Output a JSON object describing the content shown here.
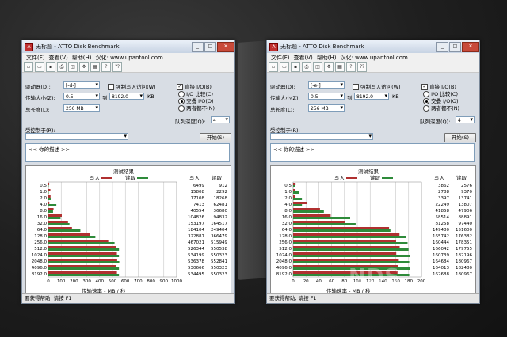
{
  "windows": [
    {
      "title": "无标题 - ATTO Disk Benchmark",
      "menu": [
        "文件(F)",
        "查看(V)",
        "帮助(H)",
        "汉化: www.upantool.com"
      ],
      "drive_label": "驱动器(D):",
      "drive_value": "[-d-]",
      "force_write_label": "强制写入访问(W)",
      "direct_io_label": "直接 I/O(B)",
      "transfer_label": "传输大小(Z):",
      "transfer_from": "0.5",
      "transfer_to_label": "到",
      "transfer_to": "8192.0",
      "transfer_unit": "KB",
      "length_label": "总长度(L):",
      "length_value": "256 MB",
      "io_compare_label": "I/O 比较(C)",
      "overlap_label": "交叠 I/O(O)",
      "neither_label": "两者都不(N)",
      "queue_label": "队列深度(Q):",
      "queue_value": "4",
      "controlled_label": "受控制于(R):",
      "start_button": "开始(S)",
      "desc_text": "<<  你的描述  >>",
      "results_title": "测试结果",
      "write_label": "写入",
      "read_label": "读取",
      "col_write": "写入",
      "col_read": "读取",
      "axis_label": "传输速率 - MB / 秒",
      "status": "要获得帮助, 请按 F1",
      "chart_data": {
        "type": "bar",
        "title": "测试结果",
        "xlabel": "传输速率 - MB / 秒",
        "xlim": [
          0,
          1000
        ],
        "xticks": [
          "0",
          "100",
          "200",
          "300",
          "400",
          "500",
          "600",
          "700",
          "800",
          "900",
          "1000"
        ],
        "categories": [
          "0.5",
          "1.0",
          "2.0",
          "4.0",
          "8.0",
          "16.0",
          "32.0",
          "64.0",
          "128.0",
          "256.0",
          "512.0",
          "1024.0",
          "2048.0",
          "4096.0",
          "8192.0"
        ],
        "series": [
          {
            "name": "写入",
            "color": "#b03030",
            "values": [
              6.499,
              15.808,
              17.108,
              7.413,
              40.554,
              104.826,
              153.197,
              184.104,
              322887,
              467021,
              526344,
              534199,
              536378,
              530666,
              534495
            ],
            "display": [
              "6499",
              "15808",
              "17108",
              "7413",
              "40554",
              "104826",
              "153197",
              "184104",
              "322887",
              "467021",
              "526344",
              "534199",
              "536378",
              "530666",
              "534495"
            ]
          },
          {
            "name": "读取",
            "color": "#2e8b3a",
            "values": [
              0.912,
              2.292,
              18.268,
              62.481,
              36.68,
              94.832,
              164.517,
              249.404,
              366.479,
              515.949,
              550.538,
              550.323,
              552.841,
              550.323,
              550.323
            ],
            "display": [
              "912",
              "2292",
              "18268",
              "62481",
              "36680",
              "94832",
              "164517",
              "249404",
              "366479",
              "515949",
              "550538",
              "550323",
              "552841",
              "550323",
              "550323"
            ]
          }
        ]
      }
    },
    {
      "title": "无标题 - ATTO Disk Benchmark",
      "menu": [
        "文件(F)",
        "查看(V)",
        "帮助(H)",
        "汉化: www.upantool.com"
      ],
      "drive_label": "驱动器(D):",
      "drive_value": "[-e-]",
      "force_write_label": "强制写入访问(W)",
      "direct_io_label": "直接 I/O(B)",
      "transfer_label": "传输大小(Z):",
      "transfer_from": "0.5",
      "transfer_to_label": "到",
      "transfer_to": "8192.0",
      "transfer_unit": "KB",
      "length_label": "总长度(L):",
      "length_value": "256 MB",
      "io_compare_label": "I/O 比较(C)",
      "overlap_label": "交叠 I/O(O)",
      "neither_label": "两者都不(N)",
      "queue_label": "队列深度(Q):",
      "queue_value": "4",
      "controlled_label": "受控制于(R):",
      "start_button": "开始(S)",
      "desc_text": "<<  你的描述  >>",
      "results_title": "测试结果",
      "write_label": "写入",
      "read_label": "读取",
      "col_write": "写入",
      "col_read": "读取",
      "axis_label": "传输速率 - MB / 秒",
      "status": "要获得帮助, 请按 F1",
      "chart_data": {
        "type": "bar",
        "title": "测试结果",
        "xlabel": "传输速率 - MB / 秒",
        "xlim": [
          0,
          200
        ],
        "xticks": [
          "0",
          "20",
          "40",
          "60",
          "80",
          "100",
          "120",
          "140",
          "160",
          "180",
          "200"
        ],
        "categories": [
          "0.5",
          "1.0",
          "2.0",
          "4.0",
          "8.0",
          "16.0",
          "32.0",
          "64.0",
          "128.0",
          "256.0",
          "512.0",
          "1024.0",
          "2048.0",
          "4096.0",
          "8192.0"
        ],
        "series": [
          {
            "name": "写入",
            "color": "#b03030",
            "values": [
              3.862,
              2.788,
              3.397,
              22.249,
              41.858,
              58.514,
              81.258,
              149.48,
              165.742,
              160.444,
              166.042,
              160.739,
              164.684,
              164.013,
              162.688
            ],
            "display": [
              "3862",
              "2788",
              "3397",
              "22249",
              "41858",
              "58514",
              "81258",
              "149480",
              "165742",
              "160444",
              "166042",
              "160739",
              "164684",
              "164013",
              "162688"
            ]
          },
          {
            "name": "读取",
            "color": "#2e8b3a",
            "values": [
              2.576,
              9.37,
              13.741,
              13.807,
              47.906,
              88.891,
              97.44,
              151.6,
              176.382,
              178.351,
              179.755,
              182.196,
              180.967,
              182.48,
              180.967
            ],
            "display": [
              "2576",
              "9370",
              "13741",
              "13807",
              "47906",
              "88891",
              "97440",
              "151600",
              "176382",
              "178351",
              "179755",
              "182196",
              "180967",
              "182480",
              "180967"
            ]
          }
        ]
      }
    }
  ],
  "watermark": "NDS"
}
